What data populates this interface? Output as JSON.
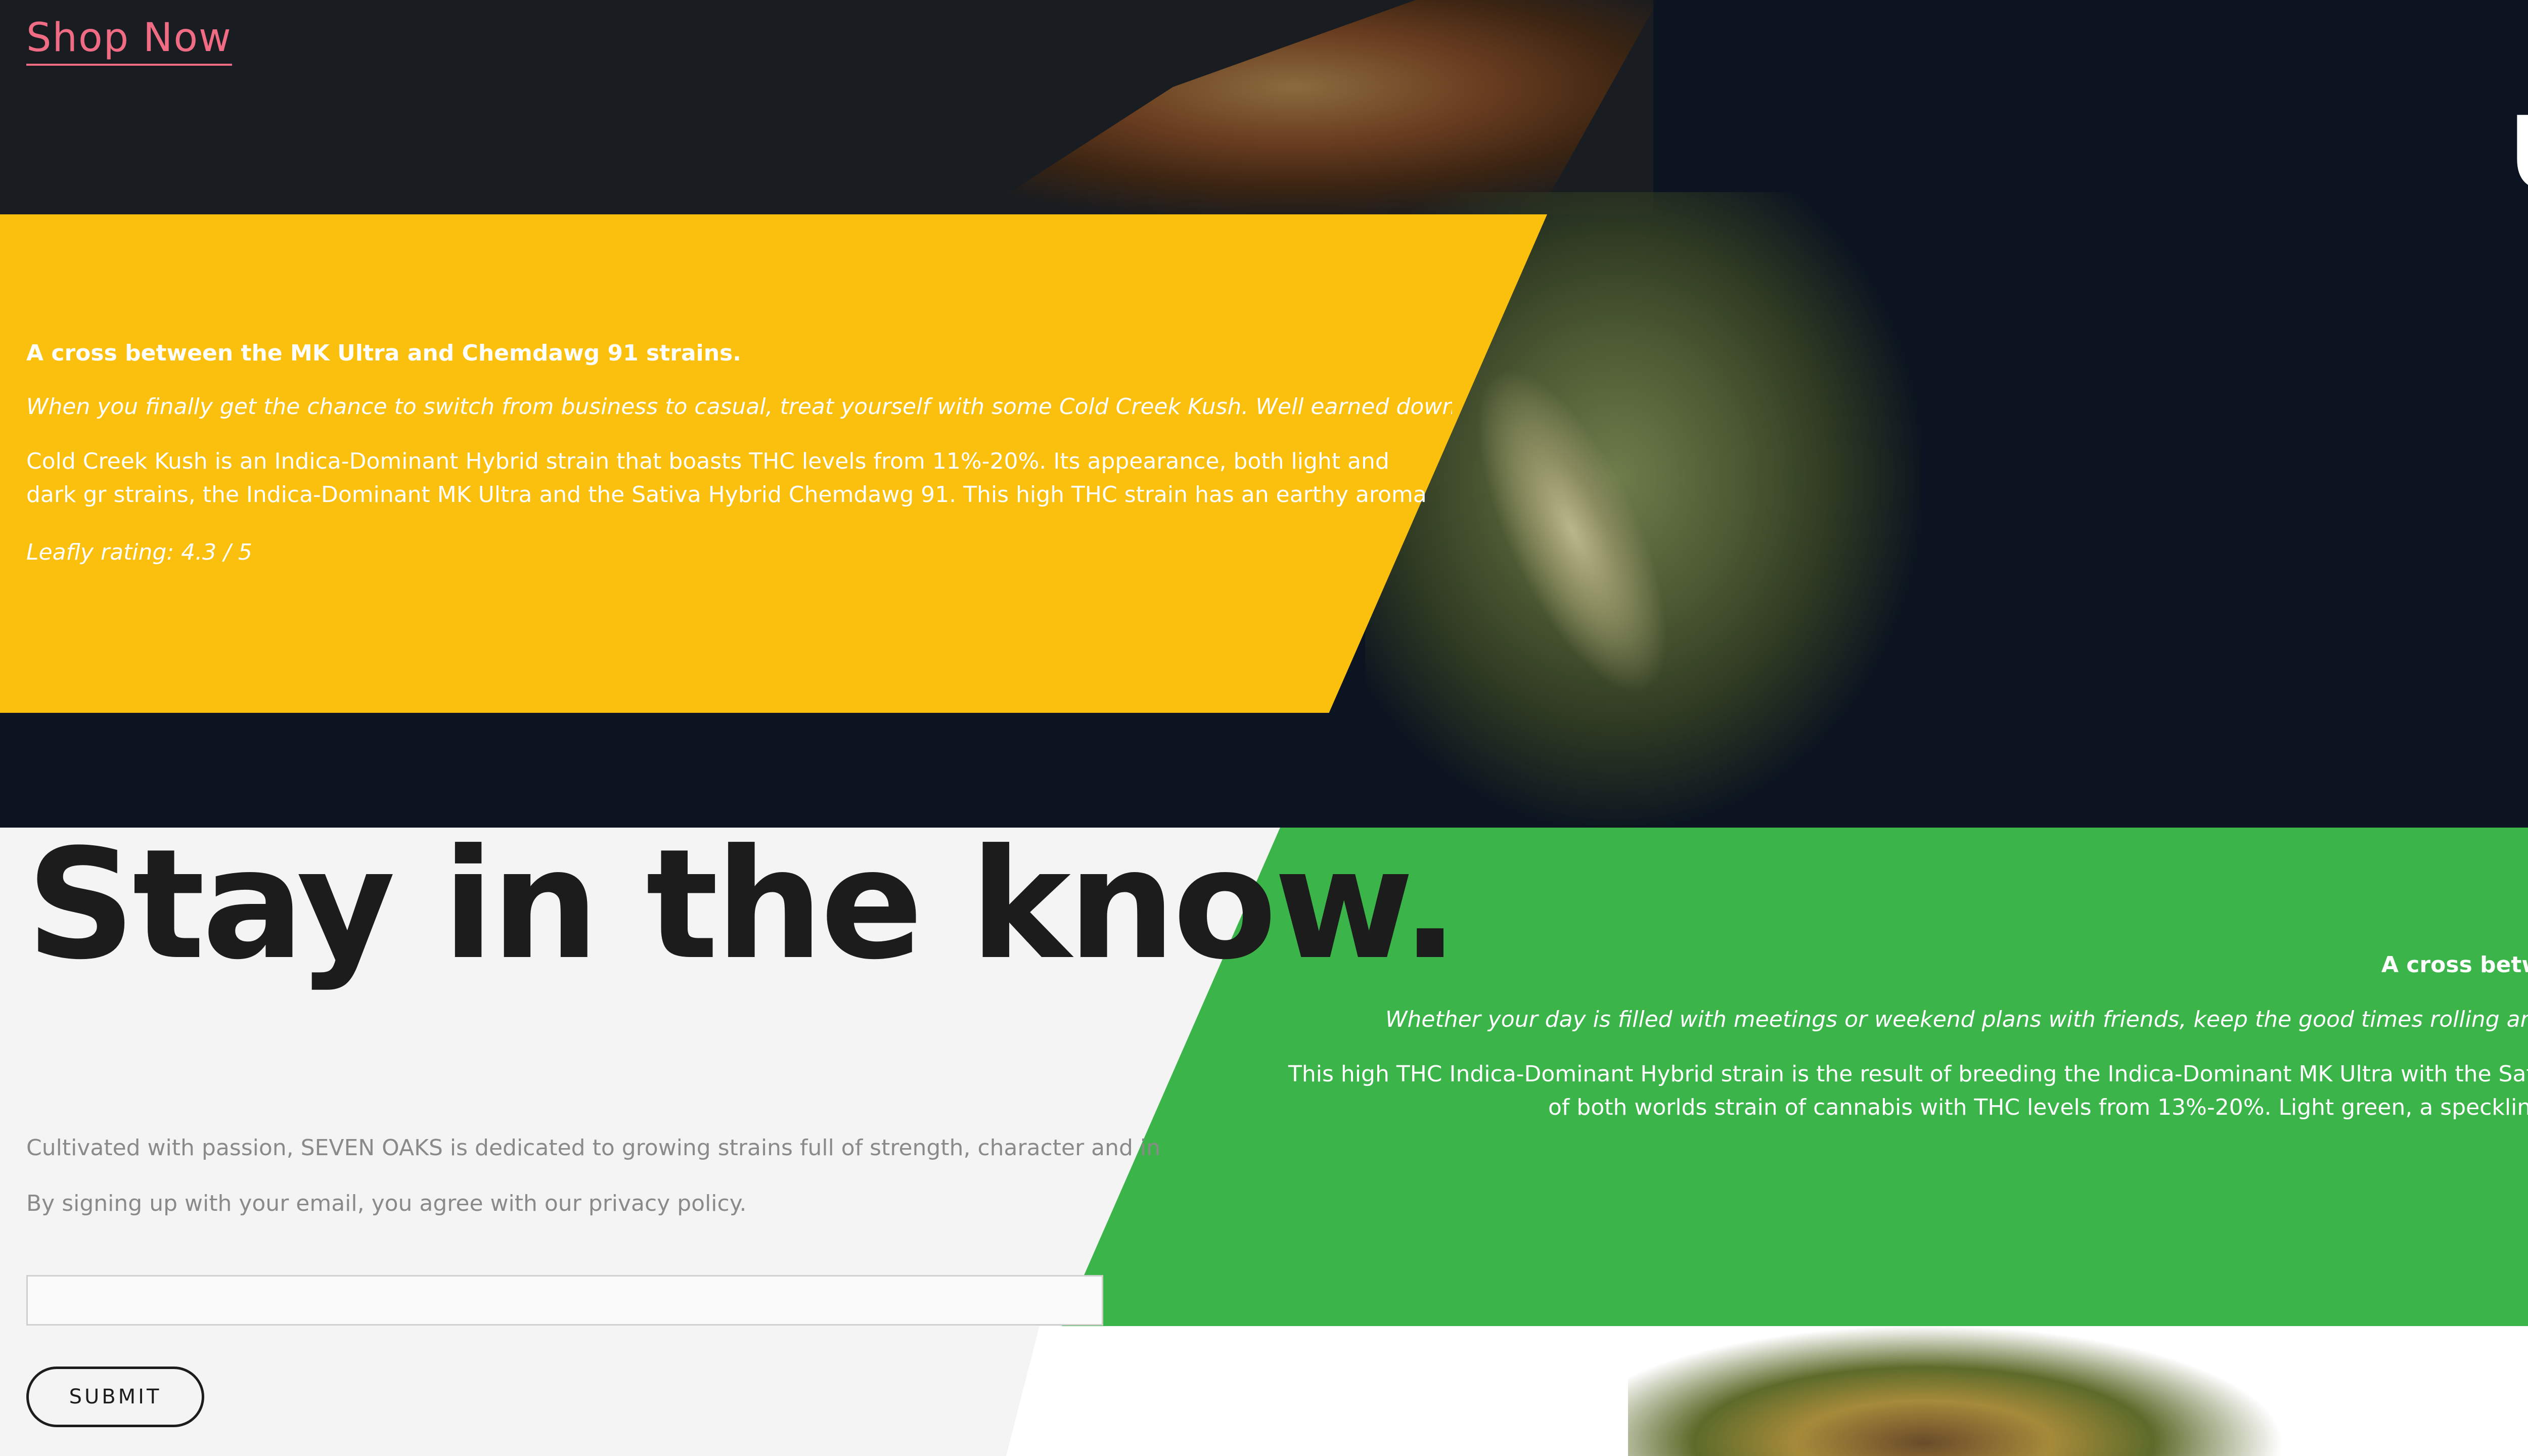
{
  "header": {
    "shop_link": "Shop Now",
    "hero_letter": "U"
  },
  "featured_strain_yellow": {
    "headline": "A cross between the MK Ultra and Chemdawg 91 strains.",
    "tagline": "When you finally get the chance to switch from business to casual, treat yourself with some Cold Creek Kush. Well earned downtime",
    "body": "Cold Creek Kush is an Indica-Dominant Hybrid strain that boasts THC levels from 11%-20%. Its appearance, both light and dark gr strains, the Indica-Dominant MK Ultra and the Sativa Hybrid Chemdawg 91. This high THC strain has an earthy aroma with hints",
    "rating": "Leafly rating: 4.3 / 5"
  },
  "newsletter": {
    "heading": "Stay in the know.",
    "description": "Cultivated with passion, SEVEN OAKS is dedicated to growing strains full of strength, character and in",
    "privacy_note": "By signing up with your email, you agree with our privacy policy.",
    "email_placeholder": "",
    "submit_label": "SUBMIT"
  },
  "featured_strain_green": {
    "headline": "A cross between t",
    "tagline": "Whether your day is filled with meetings or weekend plans with friends, keep the good times rolling and never",
    "body_line_1": "This high THC Indica-Dominant Hybrid strain is the result of breeding the Indica-Dominant MK Ultra with the Sativa-Do",
    "body_line_2": "of both worlds strain of cannabis with THC levels from 13%-20%. Light green, a speckling of ora"
  },
  "colors": {
    "accent_pink": "#f06b84",
    "panel_yellow": "#fbbf0e",
    "panel_green": "#3bb54a",
    "dark_background": "#0b1420"
  }
}
